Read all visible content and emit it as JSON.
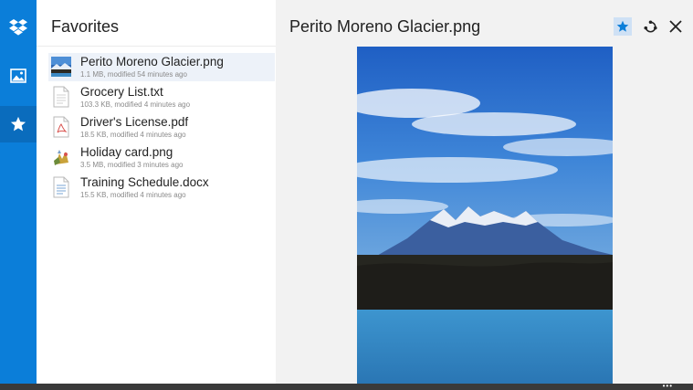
{
  "rail": {
    "items": [
      {
        "name": "dropbox"
      },
      {
        "name": "photos"
      },
      {
        "name": "favorites",
        "active": true
      }
    ]
  },
  "list": {
    "title": "Favorites",
    "files": [
      {
        "name": "Perito Moreno Glacier.png",
        "meta": "1.1 MB, modified 54 minutes ago",
        "icon": "image-thumbnail",
        "selected": true
      },
      {
        "name": "Grocery List.txt",
        "meta": "103.3 KB, modified 4 minutes ago",
        "icon": "text-file-icon"
      },
      {
        "name": "Driver's License.pdf",
        "meta": "18.5 KB, modified 4 minutes ago",
        "icon": "pdf-file-icon"
      },
      {
        "name": "Holiday card.png",
        "meta": "3.5 MB, modified 3 minutes ago",
        "icon": "image-thumbnail"
      },
      {
        "name": "Training Schedule.docx",
        "meta": "15.5 KB, modified 4 minutes ago",
        "icon": "doc-file-icon"
      }
    ]
  },
  "detail": {
    "title": "Perito Moreno Glacier.png",
    "actions": [
      "favorite",
      "share",
      "close"
    ]
  },
  "colors": {
    "accent": "#0b7ed9",
    "rail_active": "#0a6cbd",
    "selected_row": "#edf2f9",
    "detail_bg": "#f2f2f2"
  },
  "appbar": {
    "more": "•••"
  }
}
